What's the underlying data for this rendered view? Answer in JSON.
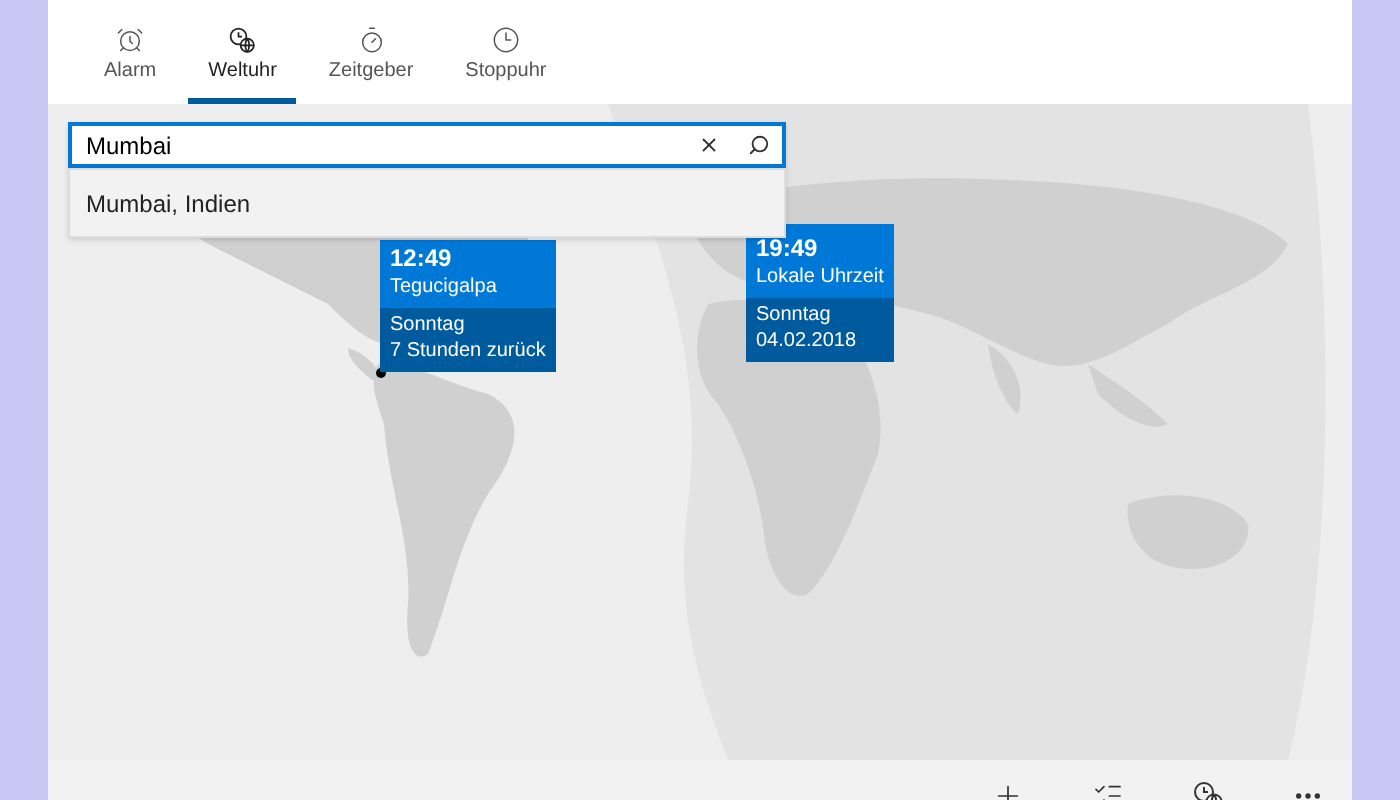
{
  "tabs": [
    {
      "label": "Alarm",
      "kind": "alarm",
      "selected": false
    },
    {
      "label": "Weltuhr",
      "kind": "world",
      "selected": true
    },
    {
      "label": "Zeitgeber",
      "kind": "timer",
      "selected": false
    },
    {
      "label": "Stoppuhr",
      "kind": "stopwatch",
      "selected": false
    }
  ],
  "search": {
    "value": "Mumbai"
  },
  "suggestions": [
    "Mumbai, Indien"
  ],
  "clocks": [
    {
      "kind": "remote",
      "time": "12:49",
      "place": "Tegucigalpa",
      "day": "Sonntag",
      "info": "7 Stunden zurück"
    },
    {
      "kind": "local",
      "time": "19:49",
      "place": "Lokale Uhrzeit",
      "day": "Sonntag",
      "info": "04.02.2018"
    }
  ]
}
